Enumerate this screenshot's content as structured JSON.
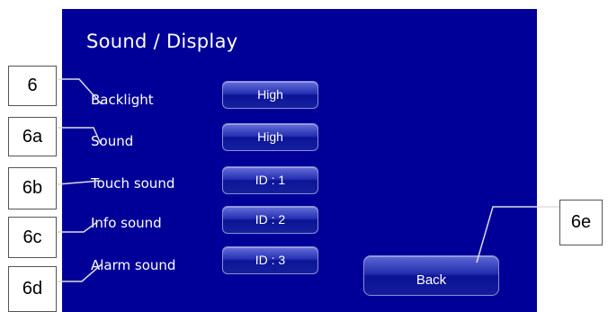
{
  "screen": {
    "title": "Sound / Display",
    "background_color": "#000099",
    "rows": [
      {
        "label": "Backlight",
        "value": "High"
      },
      {
        "label": "Sound",
        "value": "High"
      },
      {
        "label": "Touch sound",
        "value": "ID : 1"
      },
      {
        "label": "Info sound",
        "value": "ID : 2"
      },
      {
        "label": "Alarm sound",
        "value": "ID : 3"
      }
    ],
    "back_label": "Back"
  },
  "callouts": [
    "6",
    "6a",
    "6b",
    "6c",
    "6d",
    "6e"
  ]
}
